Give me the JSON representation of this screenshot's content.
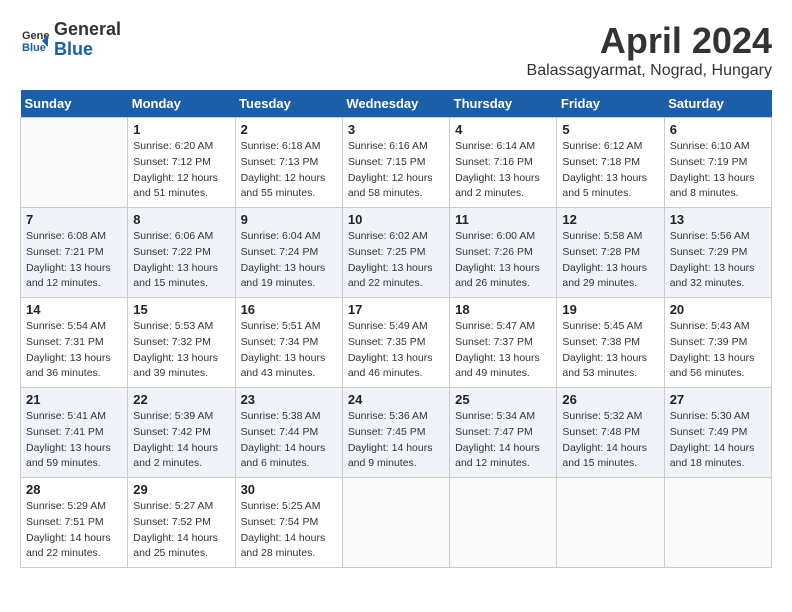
{
  "header": {
    "logo_general": "General",
    "logo_blue": "Blue",
    "title": "April 2024",
    "subtitle": "Balassagyarmat, Nograd, Hungary"
  },
  "weekdays": [
    "Sunday",
    "Monday",
    "Tuesday",
    "Wednesday",
    "Thursday",
    "Friday",
    "Saturday"
  ],
  "weeks": [
    [
      {
        "day": "",
        "sunrise": "",
        "sunset": "",
        "daylight": ""
      },
      {
        "day": "1",
        "sunrise": "Sunrise: 6:20 AM",
        "sunset": "Sunset: 7:12 PM",
        "daylight": "Daylight: 12 hours and 51 minutes."
      },
      {
        "day": "2",
        "sunrise": "Sunrise: 6:18 AM",
        "sunset": "Sunset: 7:13 PM",
        "daylight": "Daylight: 12 hours and 55 minutes."
      },
      {
        "day": "3",
        "sunrise": "Sunrise: 6:16 AM",
        "sunset": "Sunset: 7:15 PM",
        "daylight": "Daylight: 12 hours and 58 minutes."
      },
      {
        "day": "4",
        "sunrise": "Sunrise: 6:14 AM",
        "sunset": "Sunset: 7:16 PM",
        "daylight": "Daylight: 13 hours and 2 minutes."
      },
      {
        "day": "5",
        "sunrise": "Sunrise: 6:12 AM",
        "sunset": "Sunset: 7:18 PM",
        "daylight": "Daylight: 13 hours and 5 minutes."
      },
      {
        "day": "6",
        "sunrise": "Sunrise: 6:10 AM",
        "sunset": "Sunset: 7:19 PM",
        "daylight": "Daylight: 13 hours and 8 minutes."
      }
    ],
    [
      {
        "day": "7",
        "sunrise": "Sunrise: 6:08 AM",
        "sunset": "Sunset: 7:21 PM",
        "daylight": "Daylight: 13 hours and 12 minutes."
      },
      {
        "day": "8",
        "sunrise": "Sunrise: 6:06 AM",
        "sunset": "Sunset: 7:22 PM",
        "daylight": "Daylight: 13 hours and 15 minutes."
      },
      {
        "day": "9",
        "sunrise": "Sunrise: 6:04 AM",
        "sunset": "Sunset: 7:24 PM",
        "daylight": "Daylight: 13 hours and 19 minutes."
      },
      {
        "day": "10",
        "sunrise": "Sunrise: 6:02 AM",
        "sunset": "Sunset: 7:25 PM",
        "daylight": "Daylight: 13 hours and 22 minutes."
      },
      {
        "day": "11",
        "sunrise": "Sunrise: 6:00 AM",
        "sunset": "Sunset: 7:26 PM",
        "daylight": "Daylight: 13 hours and 26 minutes."
      },
      {
        "day": "12",
        "sunrise": "Sunrise: 5:58 AM",
        "sunset": "Sunset: 7:28 PM",
        "daylight": "Daylight: 13 hours and 29 minutes."
      },
      {
        "day": "13",
        "sunrise": "Sunrise: 5:56 AM",
        "sunset": "Sunset: 7:29 PM",
        "daylight": "Daylight: 13 hours and 32 minutes."
      }
    ],
    [
      {
        "day": "14",
        "sunrise": "Sunrise: 5:54 AM",
        "sunset": "Sunset: 7:31 PM",
        "daylight": "Daylight: 13 hours and 36 minutes."
      },
      {
        "day": "15",
        "sunrise": "Sunrise: 5:53 AM",
        "sunset": "Sunset: 7:32 PM",
        "daylight": "Daylight: 13 hours and 39 minutes."
      },
      {
        "day": "16",
        "sunrise": "Sunrise: 5:51 AM",
        "sunset": "Sunset: 7:34 PM",
        "daylight": "Daylight: 13 hours and 43 minutes."
      },
      {
        "day": "17",
        "sunrise": "Sunrise: 5:49 AM",
        "sunset": "Sunset: 7:35 PM",
        "daylight": "Daylight: 13 hours and 46 minutes."
      },
      {
        "day": "18",
        "sunrise": "Sunrise: 5:47 AM",
        "sunset": "Sunset: 7:37 PM",
        "daylight": "Daylight: 13 hours and 49 minutes."
      },
      {
        "day": "19",
        "sunrise": "Sunrise: 5:45 AM",
        "sunset": "Sunset: 7:38 PM",
        "daylight": "Daylight: 13 hours and 53 minutes."
      },
      {
        "day": "20",
        "sunrise": "Sunrise: 5:43 AM",
        "sunset": "Sunset: 7:39 PM",
        "daylight": "Daylight: 13 hours and 56 minutes."
      }
    ],
    [
      {
        "day": "21",
        "sunrise": "Sunrise: 5:41 AM",
        "sunset": "Sunset: 7:41 PM",
        "daylight": "Daylight: 13 hours and 59 minutes."
      },
      {
        "day": "22",
        "sunrise": "Sunrise: 5:39 AM",
        "sunset": "Sunset: 7:42 PM",
        "daylight": "Daylight: 14 hours and 2 minutes."
      },
      {
        "day": "23",
        "sunrise": "Sunrise: 5:38 AM",
        "sunset": "Sunset: 7:44 PM",
        "daylight": "Daylight: 14 hours and 6 minutes."
      },
      {
        "day": "24",
        "sunrise": "Sunrise: 5:36 AM",
        "sunset": "Sunset: 7:45 PM",
        "daylight": "Daylight: 14 hours and 9 minutes."
      },
      {
        "day": "25",
        "sunrise": "Sunrise: 5:34 AM",
        "sunset": "Sunset: 7:47 PM",
        "daylight": "Daylight: 14 hours and 12 minutes."
      },
      {
        "day": "26",
        "sunrise": "Sunrise: 5:32 AM",
        "sunset": "Sunset: 7:48 PM",
        "daylight": "Daylight: 14 hours and 15 minutes."
      },
      {
        "day": "27",
        "sunrise": "Sunrise: 5:30 AM",
        "sunset": "Sunset: 7:49 PM",
        "daylight": "Daylight: 14 hours and 18 minutes."
      }
    ],
    [
      {
        "day": "28",
        "sunrise": "Sunrise: 5:29 AM",
        "sunset": "Sunset: 7:51 PM",
        "daylight": "Daylight: 14 hours and 22 minutes."
      },
      {
        "day": "29",
        "sunrise": "Sunrise: 5:27 AM",
        "sunset": "Sunset: 7:52 PM",
        "daylight": "Daylight: 14 hours and 25 minutes."
      },
      {
        "day": "30",
        "sunrise": "Sunrise: 5:25 AM",
        "sunset": "Sunset: 7:54 PM",
        "daylight": "Daylight: 14 hours and 28 minutes."
      },
      {
        "day": "",
        "sunrise": "",
        "sunset": "",
        "daylight": ""
      },
      {
        "day": "",
        "sunrise": "",
        "sunset": "",
        "daylight": ""
      },
      {
        "day": "",
        "sunrise": "",
        "sunset": "",
        "daylight": ""
      },
      {
        "day": "",
        "sunrise": "",
        "sunset": "",
        "daylight": ""
      }
    ]
  ]
}
